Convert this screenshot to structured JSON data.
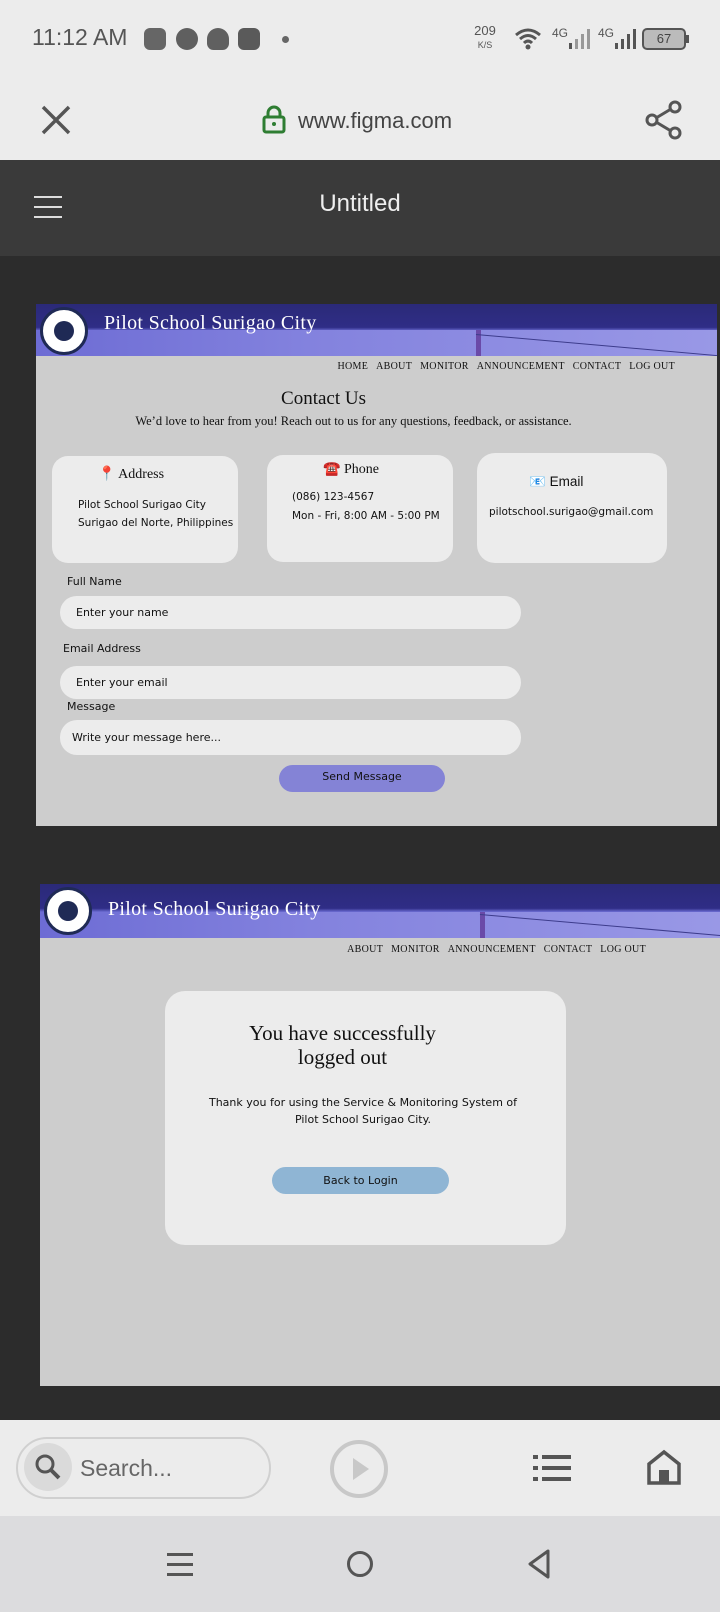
{
  "status": {
    "time": "11:12 AM",
    "speed_value": "209",
    "speed_unit": "K/S",
    "net1": "4G",
    "net2": "4G",
    "battery": "67"
  },
  "browser": {
    "url": "www.figma.com",
    "search_placeholder": "Search..."
  },
  "figma": {
    "title": "Untitled"
  },
  "frame1": {
    "school_name": "Pilot School Surigao City",
    "nav": [
      "HOME",
      "ABOUT",
      "MONITOR",
      "ANNOUNCEMENT",
      "CONTACT",
      "LOG OUT"
    ],
    "heading": "Contact Us",
    "subheading": "We’d love to hear from you! Reach out to us for any questions, feedback, or assistance.",
    "address": {
      "icon": "📍",
      "title": "Address",
      "line1": "Pilot School Surigao City",
      "line2": "Surigao del Norte, Philippines"
    },
    "phone": {
      "icon": "☎️",
      "title": "Phone",
      "line1": "(086) 123-4567",
      "line2": "Mon - Fri, 8:00 AM - 5:00 PM"
    },
    "email": {
      "icon": "📧",
      "title": "Email",
      "line1": "pilotschool.surigao@gmail.com"
    },
    "form": {
      "name_label": "Full Name",
      "name_placeholder": "Enter your name",
      "email_label": "Email Address",
      "email_placeholder": "Enter your email",
      "message_label": "Message",
      "message_placeholder": "Write your message here...",
      "send_label": "Send Message"
    }
  },
  "frame2": {
    "school_name": "Pilot School Surigao City",
    "nav": [
      "ABOUT",
      "MONITOR",
      "ANNOUNCEMENT",
      "CONTACT",
      "LOG OUT"
    ],
    "title_line1": "You have successfully",
    "title_line2": "logged out",
    "message_line1": "Thank you for using the Service & Monitoring System of",
    "message_line2": "Pilot School Surigao City.",
    "button": "Back to Login"
  },
  "colors": {
    "accent_purple": "#8483d6",
    "login_blue": "#8fb5d4",
    "lock_green": "#2e7d32"
  }
}
